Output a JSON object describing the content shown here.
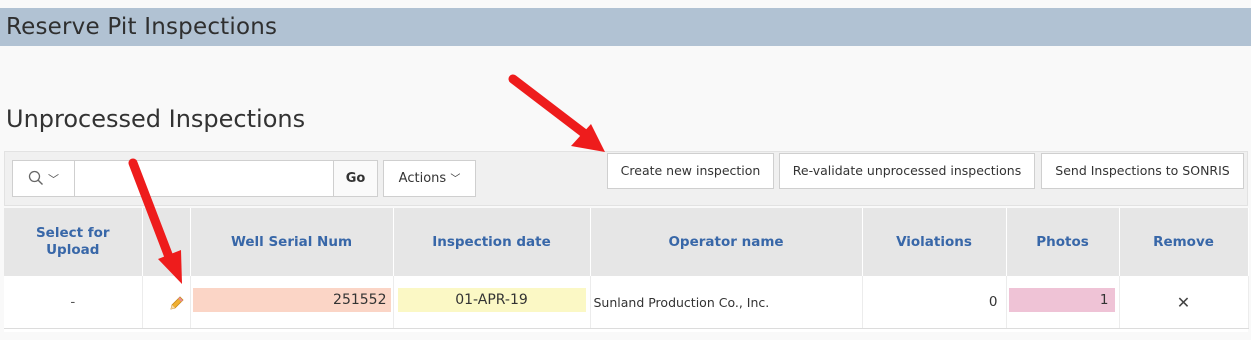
{
  "page": {
    "title": "Reserve Pit Inspections"
  },
  "region": {
    "title": "Unprocessed Inspections"
  },
  "toolbar": {
    "search_placeholder": "",
    "search_value": "",
    "go_label": "Go",
    "actions_label": "Actions",
    "create_label": "Create new inspection",
    "revalidate_label": "Re-validate unprocessed inspections",
    "send_label": "Send Inspections to SONRIS"
  },
  "table": {
    "headers": {
      "select": "Select for Upload",
      "edit": "",
      "well": "Well Serial Num",
      "date": "Inspection date",
      "operator": "Operator name",
      "violations": "Violations",
      "photos": "Photos",
      "remove": "Remove"
    },
    "rows": [
      {
        "select": "-",
        "well": "251552",
        "date": "01-APR-19",
        "operator": "Sunland Production Co., Inc.",
        "violations": "0",
        "photos": "1",
        "remove": "✕"
      }
    ]
  },
  "icons": {
    "search": "search-icon",
    "edit": "pencil-icon",
    "remove": "close-icon",
    "annotation": "red-arrow"
  },
  "colors": {
    "title_bar": "#b1c2d3",
    "header_text": "#3867a8",
    "serial_highlight": "#fbd5c6",
    "date_highlight": "#fbf8c5",
    "photos_highlight": "#efc3d6",
    "annotation_arrow": "#ee1c1c"
  }
}
